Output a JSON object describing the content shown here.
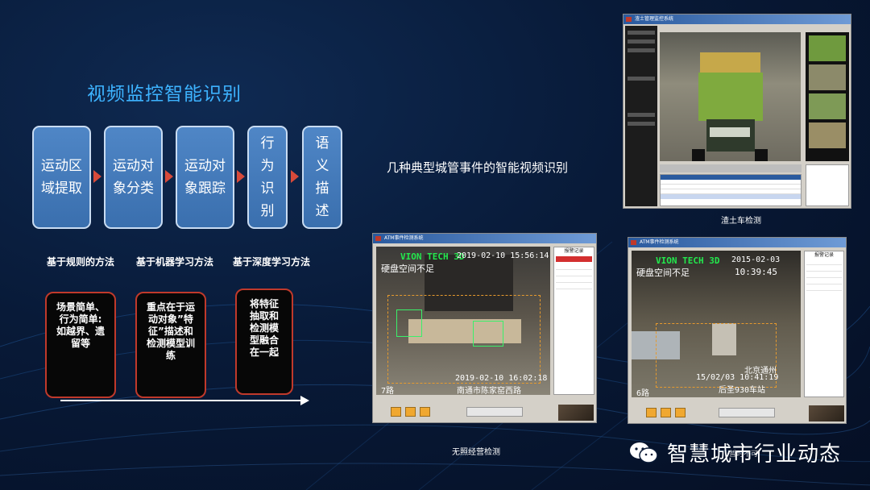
{
  "title": "视频监控智能识别",
  "flow": [
    {
      "lines": [
        "运动区",
        "域提取"
      ]
    },
    {
      "lines": [
        "运动对",
        "象分类"
      ]
    },
    {
      "lines": [
        "运动对",
        "象跟踪"
      ]
    },
    {
      "lines": [
        "行",
        "为",
        "识",
        "别"
      ]
    },
    {
      "lines": [
        "语",
        "义",
        "描",
        "述"
      ]
    }
  ],
  "methods": [
    "基于规则的方法",
    "基于机器学习方法",
    "基于深度学习方法"
  ],
  "descriptions": [
    {
      "lines": [
        "场景简单、",
        "行为简单:",
        "如越界、遗",
        "留等"
      ]
    },
    {
      "lines": [
        "重点在于运",
        "动对象”特",
        "征”描述和",
        "检测模型训",
        "练"
      ]
    },
    {
      "lines": [
        "将特征",
        "抽取和",
        "检测模",
        "型融合",
        "在一起"
      ]
    }
  ],
  "subtitle": "几种典型城管事件的智能视频识别",
  "captions": {
    "truck": "渣土车检测",
    "vendor": "无照经营检测",
    "under_watermark": "暂时不可"
  },
  "screens": {
    "vendor": {
      "app_title": "ATM事件检测系统",
      "panel_title": "报警记录",
      "vion": "VION TECH 3D",
      "warning": "硬盘空间不足",
      "timestamp_top": "2019-02-10 15:56:14",
      "timestamp_bottom": "2019-02-10 16:02:18",
      "channel": "7路",
      "location": "南通市陈家窑西路"
    },
    "crowd": {
      "app_title": "ATM事件检测系统",
      "panel_title": "报警记录",
      "vion": "VION TECH 3D",
      "warning": "硬盘空间不足",
      "timestamp_date": "2015-02-03",
      "timestamp_time": "10:39:45",
      "district": "北京通州",
      "timestamp_bottom": "15/02/03  10:41:19",
      "location": "后圣930车站",
      "channel": "6路"
    },
    "truck": {
      "app_title": "渣土管理监控系统",
      "toolbar_tabs": [
        "系统设置",
        "系统监控",
        "报警查询",
        "数据统计",
        "用户管理",
        "关于"
      ]
    }
  },
  "watermark": "智慧城市行业动态"
}
